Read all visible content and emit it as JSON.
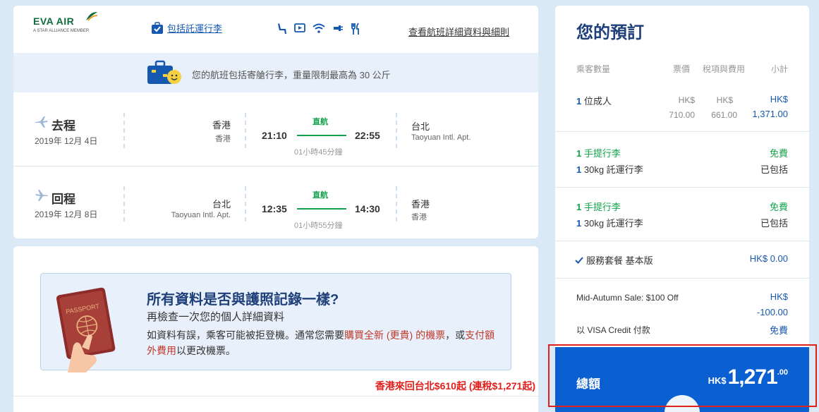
{
  "flight_card": {
    "logo_main": "EVA AIR",
    "logo_sub": "A STAR ALLIANCE MEMBER",
    "bag_link": "包括託運行李",
    "detail_link": "查看航班詳細資料與細則",
    "banner_text": "您的航班包括寄艙行李，重量限制最高為 30 公斤",
    "outbound": {
      "title": "去程",
      "date": "2019年 12月 4日",
      "from_city": "香港",
      "from_airport": "香港",
      "dep_time": "21:10",
      "direct": "直航",
      "arr_time": "22:55",
      "duration": "01小時45分鐘",
      "to_city": "台北",
      "to_airport": "Taoyuan Intl. Apt."
    },
    "return": {
      "title": "回程",
      "date": "2019年 12月 8日",
      "from_city": "台北",
      "from_airport": "Taoyuan Intl. Apt.",
      "dep_time": "12:35",
      "direct": "直航",
      "arr_time": "14:30",
      "duration": "01小時55分鐘",
      "to_city": "香港",
      "to_airport": "香港"
    }
  },
  "passport_card": {
    "title": "所有資料是否與護照記錄一樣?",
    "subtitle": "再檢查一次您的個人詳細資料",
    "body_1": "如資料有誤，乘客可能被拒登機。通常您需要",
    "body_link_1": "購買全新 (更貴) 的機票",
    "body_2": "，或",
    "body_link_2": "支付額外費用",
    "body_3": "以更改機票。",
    "passport_label": "PASSPORT",
    "promo": "香港來回台北$610起 (連稅$1,271起)"
  },
  "booking": {
    "title": "您的預訂",
    "headers": {
      "passengers": "乘客數量",
      "fare": "票價",
      "taxes": "稅項與費用",
      "subtotal": "小計"
    },
    "adult": {
      "count": "1",
      "label": "位成人",
      "fare_cur": "HK$",
      "fare": "710.00",
      "tax_cur": "HK$",
      "tax": "661.00",
      "sub_cur": "HK$",
      "sub": "1,371.00"
    },
    "bags_outbound": {
      "hand_count": "1",
      "hand_label": "手提行李",
      "hand_price": "免費",
      "checked_count": "1",
      "checked_label": "30kg 託運行李",
      "checked_price": "已包括"
    },
    "bags_return": {
      "hand_count": "1",
      "hand_label": "手提行李",
      "hand_price": "免費",
      "checked_count": "1",
      "checked_label": "30kg 託運行李",
      "checked_price": "已包括"
    },
    "service": {
      "label": "服務套餐 基本版",
      "price": "HK$ 0.00"
    },
    "discount": {
      "label": "Mid-Autumn Sale: $100 Off",
      "cur": "HK$",
      "amount": "-100.00"
    },
    "visa": {
      "label": "以 VISA Credit 付款",
      "price": "免費"
    },
    "total": {
      "label": "總額",
      "currency": "HK$",
      "integer": "1,271",
      "decimal": ".00"
    }
  },
  "colors": {
    "brand_blue": "#1558b0",
    "total_blue": "#0a5fd1",
    "green": "#12a34a",
    "highlight_red": "#e0201b"
  }
}
